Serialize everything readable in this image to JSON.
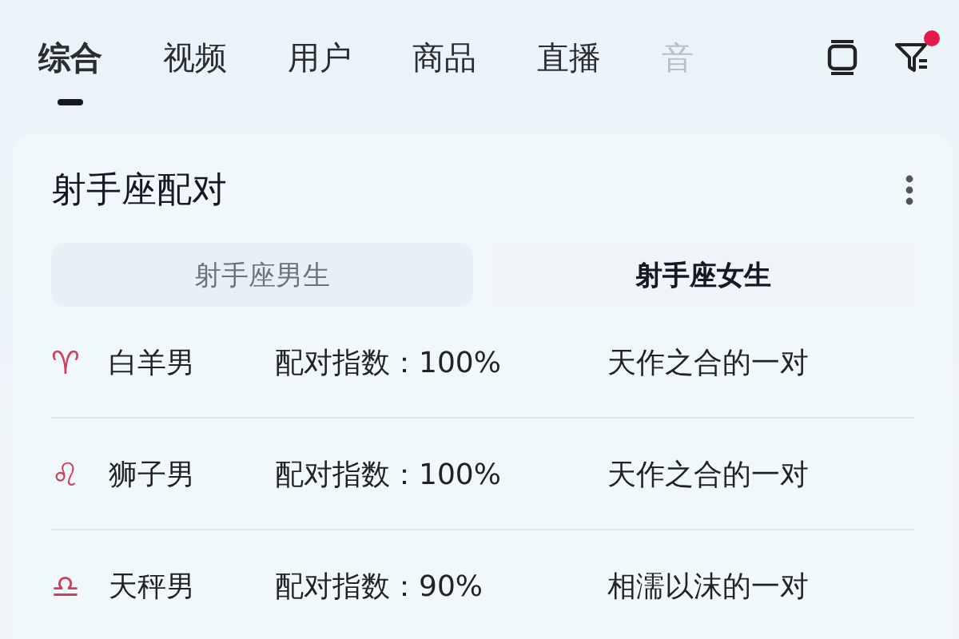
{
  "tabs": [
    {
      "label": "综合",
      "selected": true
    },
    {
      "label": "视频",
      "selected": false
    },
    {
      "label": "用户",
      "selected": false
    },
    {
      "label": "商品",
      "selected": false
    },
    {
      "label": "直播",
      "selected": false
    },
    {
      "label": "音",
      "selected": false
    }
  ],
  "filter": {
    "badge": true
  },
  "card": {
    "title": "射手座配对",
    "segments": [
      {
        "label": "射手座男生",
        "selected": false
      },
      {
        "label": "射手座女生",
        "selected": true
      }
    ],
    "rows": [
      {
        "sign": "♈",
        "name": "白羊男",
        "score": "配对指数：100%",
        "verdict": "天作之合的一对"
      },
      {
        "sign": "♌",
        "name": "狮子男",
        "score": "配对指数：100%",
        "verdict": "天作之合的一对"
      },
      {
        "sign": "♎",
        "name": "天秤男",
        "score": "配对指数：90%",
        "verdict": "相濡以沫的一对"
      }
    ]
  }
}
